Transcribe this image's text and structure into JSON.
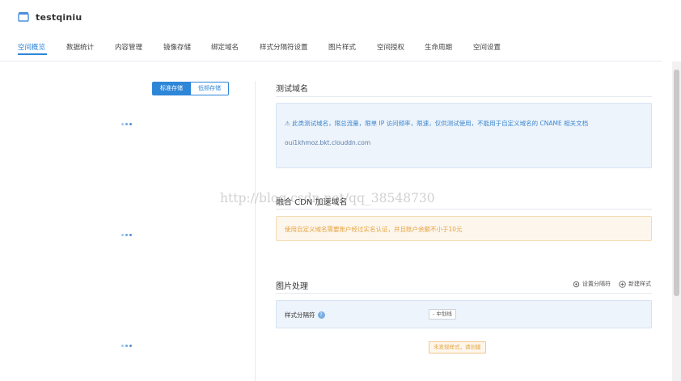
{
  "header": {
    "bucket_name": "testqiniu"
  },
  "tabs": [
    {
      "label": "空间概览",
      "active": true
    },
    {
      "label": "数据统计"
    },
    {
      "label": "内容管理"
    },
    {
      "label": "镜像存储"
    },
    {
      "label": "绑定域名"
    },
    {
      "label": "样式分隔符设置"
    },
    {
      "label": "图片样式"
    },
    {
      "label": "空间授权"
    },
    {
      "label": "生命周期"
    },
    {
      "label": "空间设置"
    }
  ],
  "storage_toggle": {
    "standard": "标准存储",
    "low_freq": "低频存储"
  },
  "test_domain": {
    "title": "测试域名",
    "notice": "⚠ 此类测试域名，限总流量，限单 IP 访问频率，限速，仅供测试使用，不能用于自定义域名的 CNAME 相关文档",
    "domain": "oui1khmoz.bkt.clouddn.com"
  },
  "cdn": {
    "title": "融合 CDN 加速域名",
    "warning": "使用自定义域名需要账户经过实名认证，并且账户余额不小于10元"
  },
  "image_processing": {
    "title": "图片处理",
    "set_separator": "设置分隔符",
    "new_style": "新建样式",
    "separator_label": "样式分隔符",
    "separator_value": "- 中划线",
    "empty_notice": "未发现样式，请创建"
  },
  "watermark": "http://blog.csdn.net/qq_38548730",
  "colors": {
    "accent": "#2e86d8",
    "warning": "#e6a23c"
  }
}
